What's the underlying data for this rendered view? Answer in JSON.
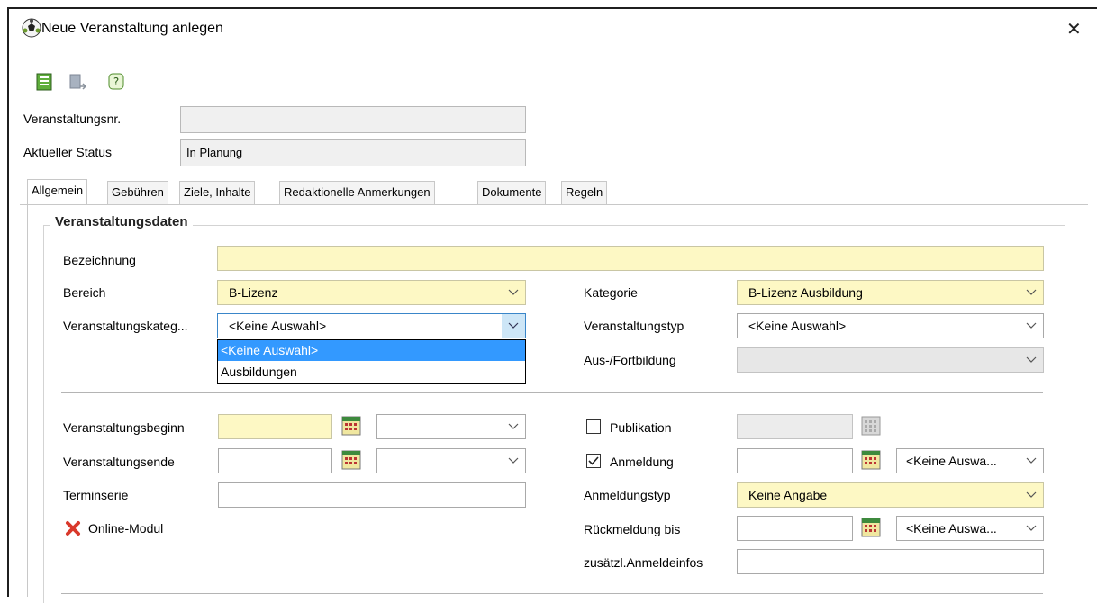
{
  "window": {
    "title": "Neue Veranstaltung anlegen"
  },
  "icons": {
    "app": "soccer-ball-icon",
    "save": "save-form-icon",
    "export": "book-arrow-icon",
    "help": "help-question-icon",
    "close": "close-icon",
    "calendar": "calendar-icon",
    "online_status": "red-x-icon"
  },
  "header": {
    "nr_label": "Veranstaltungsnr.",
    "nr_value": "",
    "status_label": "Aktueller Status",
    "status_value": "In Planung"
  },
  "tabs": [
    {
      "label": "Allgemein"
    },
    {
      "label": "Gebühren"
    },
    {
      "label": "Ziele, Inhalte"
    },
    {
      "label": "Redaktionelle Anmerkungen"
    },
    {
      "label": "Dokumente"
    },
    {
      "label": "Regeln"
    }
  ],
  "group": {
    "title": "Veranstaltungsdaten"
  },
  "form": {
    "bezeichnung_label": "Bezeichnung",
    "bezeichnung_value": "",
    "bereich_label": "Bereich",
    "bereich_value": "B-Lizenz",
    "kategorie_label": "Kategorie",
    "kategorie_value": "B-Lizenz Ausbildung",
    "vkat_label": "Veranstaltungskateg...",
    "vkat_value": "<Keine Auswahl>",
    "vkat_options": [
      "<Keine Auswahl>",
      "Ausbildungen"
    ],
    "vtyp_label": "Veranstaltungstyp",
    "vtyp_value": "<Keine Auswahl>",
    "ausfort_label": "Aus-/Fortbildung",
    "ausfort_value": "",
    "beginn_label": "Veranstaltungsbeginn",
    "ende_label": "Veranstaltungsende",
    "terminserie_label": "Terminserie",
    "online_label": "Online-Modul",
    "publikation_label": "Publikation",
    "anmeldung_label": "Anmeldung",
    "anmeldung_select": "<Keine Auswa...",
    "anmeldungstyp_label": "Anmeldungstyp",
    "anmeldungstyp_value": "Keine Angabe",
    "rueckmeldung_label": "Rückmeldung bis",
    "rueckmeldung_select": "<Keine Auswa...",
    "zusatz_label": "zusätzl.Anmeldeinfos"
  },
  "colors": {
    "required_field": "#fdf8c4",
    "selection": "#3399ff",
    "readonly": "#f0f0f0"
  }
}
